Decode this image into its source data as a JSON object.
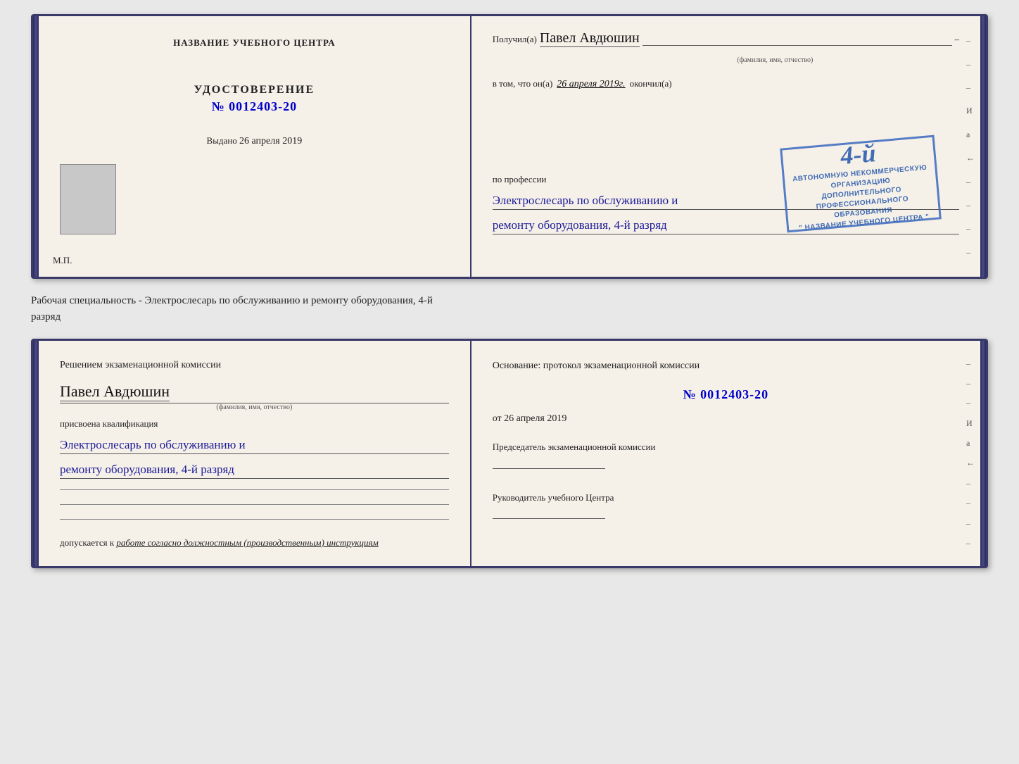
{
  "top_book": {
    "left_page": {
      "title": "НАЗВАНИЕ УЧЕБНОГО ЦЕНТРА",
      "cert_type": "УДОСТОВЕРЕНИЕ",
      "cert_number": "№ 0012403-20",
      "issued_label": "Выдано",
      "issued_date": "26 апреля 2019",
      "mp_label": "М.П."
    },
    "right_page": {
      "received_label": "Получил(а)",
      "name": "Павел Авдюшин",
      "name_subtitle": "(фамилия, имя, отчество)",
      "in_that_label": "в том, что он(а)",
      "date_value": "26 апреля 2019г.",
      "finished_label": "окончил(а)",
      "stamp_line1": "АВТОНОМНУЮ НЕКОММЕРЧЕСКУЮ ОРГАНИЗАЦИЮ",
      "stamp_line2": "ДОПОЛНИТЕЛЬНОГО ПРОФЕССИОНАЛЬНОГО ОБРАЗОВАНИЯ",
      "stamp_line3": "\" НАЗВАНИЕ УЧЕБНОГО ЦЕНТРА \"",
      "stamp_grade": "4-й",
      "profession_label": "по профессии",
      "profession_line1": "Электрослесарь по обслуживанию и",
      "profession_line2": "ремонту оборудования, 4-й разряд",
      "side_dashes": [
        "–",
        "–",
        "–",
        "И",
        "а",
        "←",
        "–",
        "–",
        "–",
        "–"
      ]
    }
  },
  "middle_text": {
    "line1": "Рабочая специальность - Электрослесарь по обслуживанию и ремонту оборудования, 4-й",
    "line2": "разряд"
  },
  "bottom_book": {
    "left_page": {
      "decision_title": "Решением экзаменационной комиссии",
      "name": "Павел Авдюшин",
      "name_subtitle": "(фамилия, имя, отчество)",
      "assigned_label": "присвоена квалификация",
      "qual_line1": "Электрослесарь по обслуживанию и",
      "qual_line2": "ремонту оборудования, 4-й разряд",
      "blank_lines": 3,
      "allowed_label": "допускается к",
      "allowed_value": "работе согласно должностным (производственным) инструкциям"
    },
    "right_page": {
      "basis_label": "Основание: протокол экзаменационной комиссии",
      "basis_number": "№  0012403-20",
      "basis_date_label": "от",
      "basis_date": "26 апреля 2019",
      "chairman_title": "Председатель экзаменационной комиссии",
      "director_title": "Руководитель учебного Центра",
      "side_dashes": [
        "–",
        "–",
        "–",
        "И",
        "а",
        "←",
        "–",
        "–",
        "–",
        "–"
      ]
    }
  }
}
